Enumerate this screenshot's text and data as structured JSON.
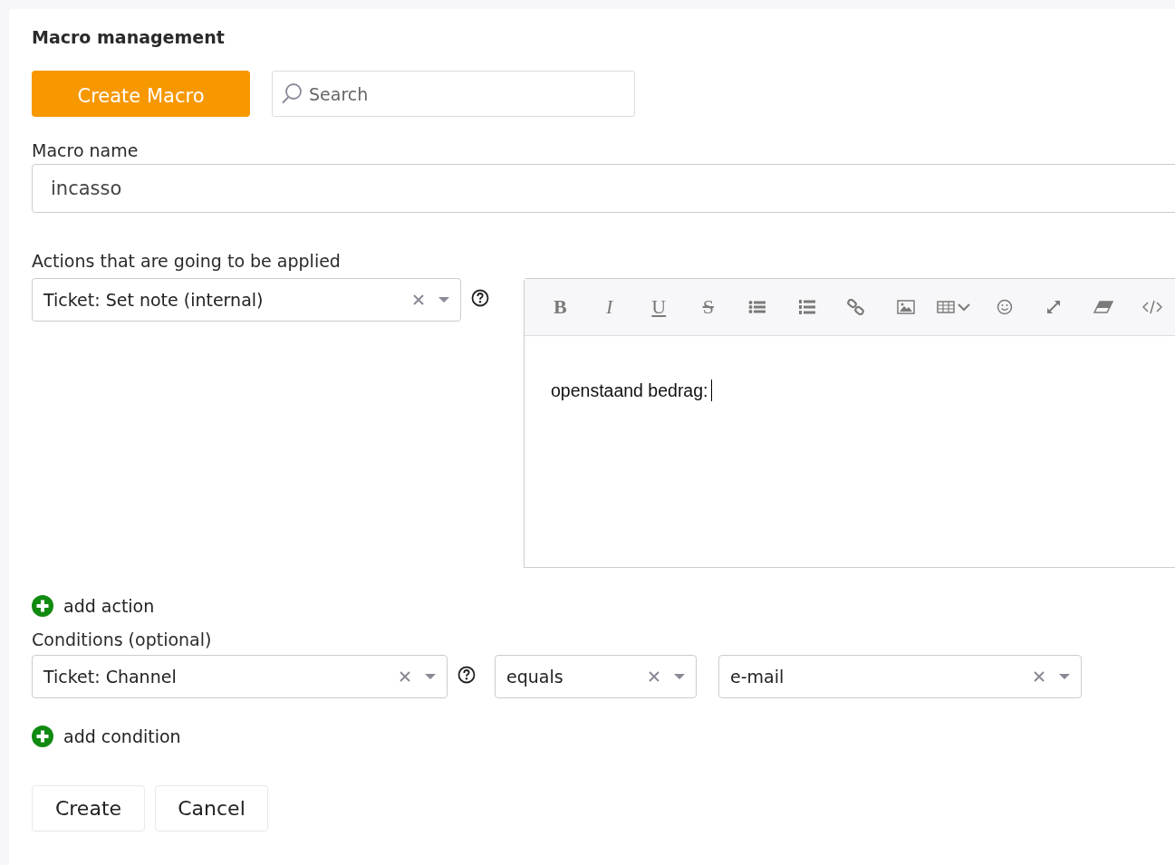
{
  "title": "Macro management",
  "create_macro_button": "Create Macro",
  "search": {
    "placeholder": "Search"
  },
  "macro_name": {
    "label": "Macro name",
    "value": "incasso"
  },
  "actions": {
    "label": "Actions that are going to be applied",
    "select": "Ticket: Set note (internal)",
    "editor": {
      "toolbar": [
        {
          "kind": "bold",
          "label": "B"
        },
        {
          "kind": "italic",
          "label": "I"
        },
        {
          "kind": "underline",
          "label": "U"
        },
        {
          "kind": "strike",
          "label": "S"
        },
        {
          "kind": "bullets"
        },
        {
          "kind": "numbers"
        },
        {
          "kind": "link"
        },
        {
          "kind": "image"
        },
        {
          "kind": "table"
        },
        {
          "kind": "emoji"
        },
        {
          "kind": "fullscreen"
        },
        {
          "kind": "eraser"
        },
        {
          "kind": "code"
        }
      ],
      "content": "openstaand bedrag:"
    },
    "add_label": "add action"
  },
  "conditions": {
    "label": "Conditions (optional)",
    "attribute": "Ticket: Channel",
    "operator": "equals",
    "value": "e-mail",
    "add_label": "add condition"
  },
  "buttons": [
    "Create",
    "Cancel"
  ]
}
